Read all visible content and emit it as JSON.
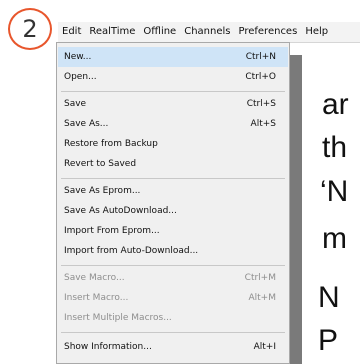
{
  "badge": {
    "number": "2"
  },
  "menubar": {
    "items": [
      "Edit",
      "RealTime",
      "Offline",
      "Channels",
      "Preferences",
      "Help"
    ]
  },
  "menu": {
    "items": [
      {
        "label": "New...",
        "shortcut": "Ctrl+N",
        "disabled": false,
        "highlight": true
      },
      {
        "label": "Open...",
        "shortcut": "Ctrl+O",
        "disabled": false
      },
      {
        "label": "Save",
        "shortcut": "Ctrl+S",
        "disabled": false
      },
      {
        "label": "Save As...",
        "shortcut": "Alt+S",
        "disabled": false
      },
      {
        "label": "Restore from Backup",
        "shortcut": "",
        "disabled": false
      },
      {
        "label": "Revert to Saved",
        "shortcut": "",
        "disabled": false
      },
      {
        "label": "Save As Eprom...",
        "shortcut": "",
        "disabled": false
      },
      {
        "label": "Save As AutoDownload...",
        "shortcut": "",
        "disabled": false
      },
      {
        "label": "Import From Eprom...",
        "shortcut": "",
        "disabled": false
      },
      {
        "label": "Import from Auto-Download...",
        "shortcut": "",
        "disabled": false
      },
      {
        "label": "Save Macro...",
        "shortcut": "Ctrl+M",
        "disabled": true
      },
      {
        "label": "Insert Macro...",
        "shortcut": "Alt+M",
        "disabled": true
      },
      {
        "label": "Insert Multiple Macros...",
        "shortcut": "",
        "disabled": true
      },
      {
        "label": "Show Information...",
        "shortcut": "Alt+I",
        "disabled": false
      }
    ]
  },
  "background_text": {
    "line1": "ar",
    "line2": "th",
    "line3": "‘N",
    "line4": "m",
    "line5": "N",
    "line6": "P"
  },
  "colors": {
    "badge_border": "#e8562c",
    "highlight": "#cfe4f7"
  }
}
